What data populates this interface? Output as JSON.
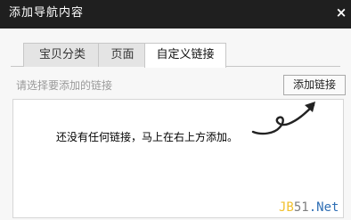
{
  "window": {
    "title": "添加导航内容",
    "close_glyph": "×"
  },
  "tabs": [
    {
      "label": "宝贝分类",
      "active": false
    },
    {
      "label": "页面",
      "active": false
    },
    {
      "label": "自定义链接",
      "active": true
    }
  ],
  "toolbar": {
    "hint": "请选择要添加的链接",
    "add_link_label": "添加链接"
  },
  "panel": {
    "empty_message": "还没有任何链接，马上在右上方添加。",
    "arrow_icon": "curly-arrow-pointing-up-right"
  },
  "watermark": {
    "part_a": "JB",
    "part_b": "51",
    "part_c": ".Net"
  },
  "colors": {
    "titlebar_bg": "#1f1f1f",
    "active_tab_bg": "#ffffff",
    "tab_bg": "#e4e4e4"
  }
}
